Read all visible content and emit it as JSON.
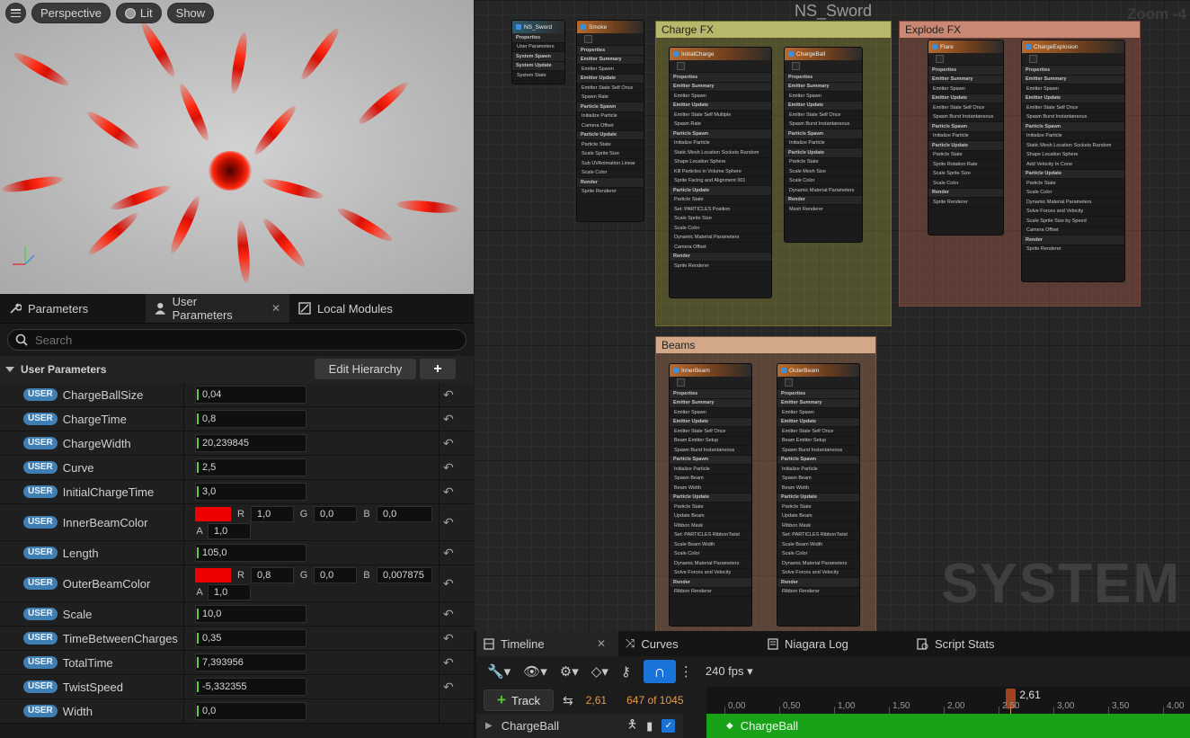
{
  "viewport": {
    "buttons": [
      "Perspective",
      "Lit",
      "Show"
    ],
    "axis_labels": {
      "x": "x",
      "z": "z",
      "y": "y"
    }
  },
  "details": {
    "tabs": [
      {
        "label": "Parameters",
        "icon": "wrench-icon"
      },
      {
        "label": "User Parameters",
        "icon": "user-icon"
      },
      {
        "label": "Local Modules",
        "icon": "module-icon"
      }
    ],
    "search_placeholder": "Search",
    "section_title": "User Parameters",
    "edit_hierarchy_label": "Edit Hierarchy",
    "add_label": "+",
    "badge_label": "USER",
    "params": [
      {
        "name": "ChargeBallSize",
        "value": "0,04"
      },
      {
        "name": "ChargeTime",
        "value": "0,8"
      },
      {
        "name": "ChargeWidth",
        "value": "20,239845"
      },
      {
        "name": "Curve",
        "value": "2,5"
      },
      {
        "name": "InitialChargeTime",
        "value": "3,0"
      },
      {
        "name": "InnerBeamColor",
        "r": "1,0",
        "g": "0,0",
        "b": "0,0",
        "a": "1,0",
        "swatch": "#ec0000"
      },
      {
        "name": "Length",
        "value": "105,0"
      },
      {
        "name": "OuterBeamColor",
        "r": "0,8",
        "g": "0,0",
        "b": "0,007875",
        "a": "1,0",
        "swatch": "#ec0000"
      },
      {
        "name": "Scale",
        "value": "10,0"
      },
      {
        "name": "TimeBetweenCharges",
        "value": "0,35"
      },
      {
        "name": "TotalTime",
        "value": "7,393956"
      },
      {
        "name": "TwistSpeed",
        "value": "-5,332355"
      },
      {
        "name": "Width",
        "value": "0,0"
      }
    ],
    "color_labels": {
      "r": "R",
      "g": "G",
      "b": "B",
      "a": "A"
    }
  },
  "graph": {
    "title": "NS_Sword",
    "zoom": "Zoom -4",
    "watermark": "SYSTEM",
    "comments": [
      "Charge FX",
      "Explode FX",
      "Beams"
    ],
    "nodes": {
      "system": {
        "title": "NS_Sword",
        "lines": [
          "Properties",
          "User Parameters",
          "System Spawn",
          "System Update",
          "System State"
        ]
      },
      "smoke": {
        "title": "Smoke",
        "lines": [
          "Properties",
          "Emitter Summary",
          "Emitter Spawn",
          "Emitter Update",
          "Emitter State  Self  Once",
          "Spawn Rate",
          "Particle Spawn",
          "Initialize Particle",
          "Camera Offset",
          "Particle Update",
          "Particle State",
          "Scale Sprite Size",
          "Sub UVAnimation  Linear",
          "Scale Color",
          "Render",
          "Sprite Renderer"
        ]
      },
      "initial_charge": {
        "title": "InitialCharge",
        "lines": [
          "Properties",
          "Emitter Summary",
          "Emitter Spawn",
          "Emitter Update",
          "Emitter State  Self  Multiple",
          "Spawn Rate",
          "Particle Spawn",
          "Initialize Particle",
          "Static Mesh Location  Sockets  Random",
          "Shape Location  Sphere",
          "Kill Particles in Volume  Sphere",
          "Sprite Facing and Alignment 001",
          "Particle Update",
          "Particle State",
          "Set:  PARTICLES  Position",
          "Scale Sprite Size",
          "Scale Color",
          "Dynamic Material Parameters",
          "Camera Offset",
          "Render",
          "Sprite Renderer"
        ]
      },
      "charge_ball": {
        "title": "ChargeBall",
        "lines": [
          "Properties",
          "Emitter Summary",
          "Emitter Spawn",
          "Emitter Update",
          "Emitter State  Self  Once",
          "Spawn Burst Instantaneous",
          "Particle Spawn",
          "Initialize Particle",
          "Particle Update",
          "Particle State",
          "Scale Mesh Size",
          "Scale Color",
          "Dynamic Material Parameters",
          "Render",
          "Mesh Renderer"
        ]
      },
      "flare": {
        "title": "Flare",
        "lines": [
          "Properties",
          "Emitter Summary",
          "Emitter Spawn",
          "Emitter Update",
          "Emitter State  Self  Once",
          "Spawn Burst Instantaneous",
          "Particle Spawn",
          "Initialize Particle",
          "Particle Update",
          "Particle State",
          "Sprite Rotation Rate",
          "Scale Sprite Size",
          "Scale Color",
          "Render",
          "Sprite Renderer"
        ]
      },
      "charge_explosion": {
        "title": "ChargeExplosion",
        "lines": [
          "Properties",
          "Emitter Summary",
          "Emitter Spawn",
          "Emitter Update",
          "Emitter State  Self  Once",
          "Spawn Burst Instantaneous",
          "Particle Spawn",
          "Initialize Particle",
          "Static Mesh Location  Sockets  Random",
          "Shape Location  Sphere",
          "Add Velocity  In Cone",
          "Particle Update",
          "Particle State",
          "Scale Color",
          "Dynamic Material Parameters",
          "Solve Forces and Velocity",
          "Scale Sprite Size by Speed",
          "Camera Offset",
          "Render",
          "Sprite Renderer"
        ]
      },
      "inner_beam": {
        "title": "InnerBeam",
        "lines": [
          "Properties",
          "Emitter Summary",
          "Emitter Spawn",
          "Emitter Update",
          "Emitter State  Self  Once",
          "Beam Emitter Setup",
          "Spawn Burst Instantaneous",
          "Particle Spawn",
          "Initialize Particle",
          "Spawn Beam",
          "Beam Width",
          "Particle Update",
          "Particle State",
          "Update Beam",
          "Ribbon Mask",
          "Set:  PARTICLES  RibbonTwist",
          "Scale Beam Width",
          "Scale Color",
          "Dynamic Material Parameters",
          "Solve Forces and Velocity",
          "Render",
          "Ribbon Renderer"
        ]
      },
      "outer_beam": {
        "title": "OuterBeam",
        "lines": [
          "Properties",
          "Emitter Summary",
          "Emitter Spawn",
          "Emitter Update",
          "Emitter State  Self  Once",
          "Beam Emitter Setup",
          "Spawn Burst Instantaneous",
          "Particle Spawn",
          "Initialize Particle",
          "Spawn Beam",
          "Beam Width",
          "Particle Update",
          "Particle State",
          "Update Beam",
          "Ribbon Mask",
          "Set:  PARTICLES  RibbonTwist",
          "Scale Beam Width",
          "Scale Color",
          "Dynamic Material Parameters",
          "Solve Forces and Velocity",
          "Render",
          "Ribbon Renderer"
        ]
      }
    }
  },
  "timeline": {
    "tabs": [
      {
        "label": "Timeline",
        "icon": "film-icon"
      },
      {
        "label": "Curves",
        "icon": "curves-icon"
      },
      {
        "label": "Niagara Log",
        "icon": "log-icon"
      },
      {
        "label": "Script Stats",
        "icon": "stats-icon"
      }
    ],
    "fps": "240 fps",
    "track_button": "Track",
    "current_time": "2,61",
    "frame_count": "647 of 1045",
    "playhead_label": "2,61",
    "ticks": [
      "0,00",
      "0,50",
      "1,00",
      "1,50",
      "2,00",
      "2,50",
      "3,00",
      "3,50",
      "4,00"
    ],
    "playhead_time": 2.61,
    "track_name": "ChargeBall",
    "track_bar_label": "ChargeBall",
    "colors": {
      "track_bar": "#18a218",
      "accent": "#1a73d8",
      "time": "#e59b3e"
    }
  }
}
